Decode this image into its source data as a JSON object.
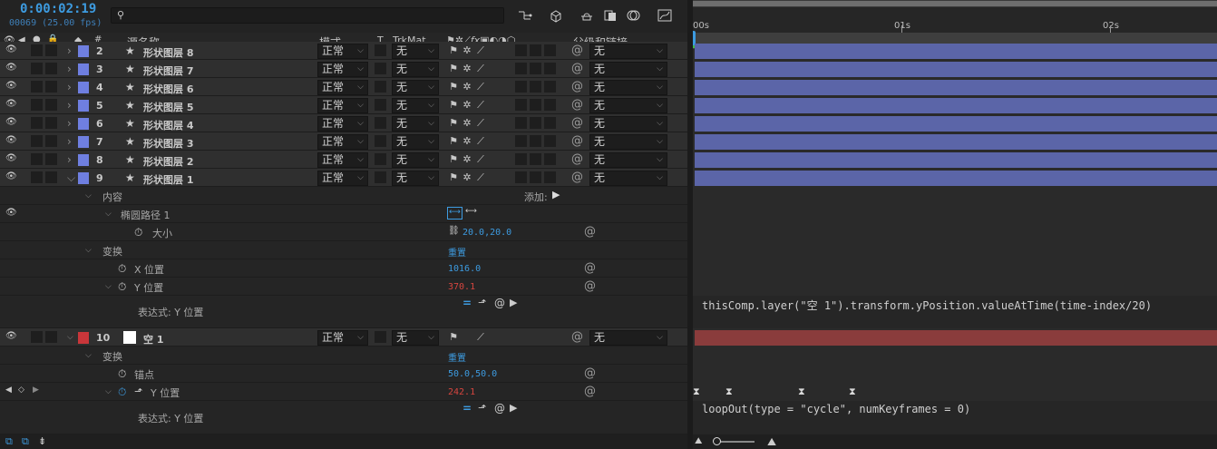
{
  "header": {
    "timecode": "0:00:02:19",
    "frame_info": "00069 (25.00 fps)",
    "search_placeholder": ""
  },
  "columns": {
    "source_name": "源名称",
    "mode": "模式",
    "t": "T",
    "trkmat": "TrkMat",
    "parent_link": "父级和链接",
    "hash": "#"
  },
  "layers": [
    {
      "num": "2",
      "name": "形状图层 8",
      "mode": "正常",
      "trkmat": "无",
      "parent": "无"
    },
    {
      "num": "3",
      "name": "形状图层 7",
      "mode": "正常",
      "trkmat": "无",
      "parent": "无"
    },
    {
      "num": "4",
      "name": "形状图层 6",
      "mode": "正常",
      "trkmat": "无",
      "parent": "无"
    },
    {
      "num": "5",
      "name": "形状图层 5",
      "mode": "正常",
      "trkmat": "无",
      "parent": "无"
    },
    {
      "num": "6",
      "name": "形状图层 4",
      "mode": "正常",
      "trkmat": "无",
      "parent": "无"
    },
    {
      "num": "7",
      "name": "形状图层 3",
      "mode": "正常",
      "trkmat": "无",
      "parent": "无"
    },
    {
      "num": "8",
      "name": "形状图层 2",
      "mode": "正常",
      "trkmat": "无",
      "parent": "无"
    },
    {
      "num": "9",
      "name": "形状图层 1",
      "mode": "正常",
      "trkmat": "无",
      "parent": "无"
    }
  ],
  "layer9_props": {
    "contents": "内容",
    "add_label": "添加:",
    "ellipse_path": "椭圆路径 1",
    "size_label": "大小",
    "size_value": "20.0,20.0",
    "transform": "变换",
    "reset": "重置",
    "x_pos_label": "X 位置",
    "x_pos_value": "1016.0",
    "y_pos_label": "Y 位置",
    "y_pos_value": "370.1",
    "expr_label": "表达式: Y 位置"
  },
  "layer10": {
    "num": "10",
    "name": "空 1",
    "mode": "正常",
    "trkmat": "无",
    "parent": "无",
    "label_color": "#c8363a"
  },
  "layer10_props": {
    "transform": "变换",
    "reset": "重置",
    "anchor_label": "锚点",
    "anchor_value": "50.0,50.0",
    "y_pos_label": "Y 位置",
    "y_pos_value": "242.1",
    "expr_label": "表达式: Y 位置"
  },
  "timeline": {
    "ruler": [
      "00s",
      "01s",
      "02s"
    ],
    "expr1": "thisComp.layer(\"空 1\").transform.yPosition.valueAtTime(time-index/20)",
    "expr2": "loopOut(type = \"cycle\", numKeyframes = 0)",
    "layer_bar_color": "#5b65a8",
    "null_bar_color": "#8a3c3c"
  },
  "colors": {
    "label_blue": "#6f7fe0",
    "timecode_blue": "#3d9be0",
    "value_red": "#d6453f"
  }
}
